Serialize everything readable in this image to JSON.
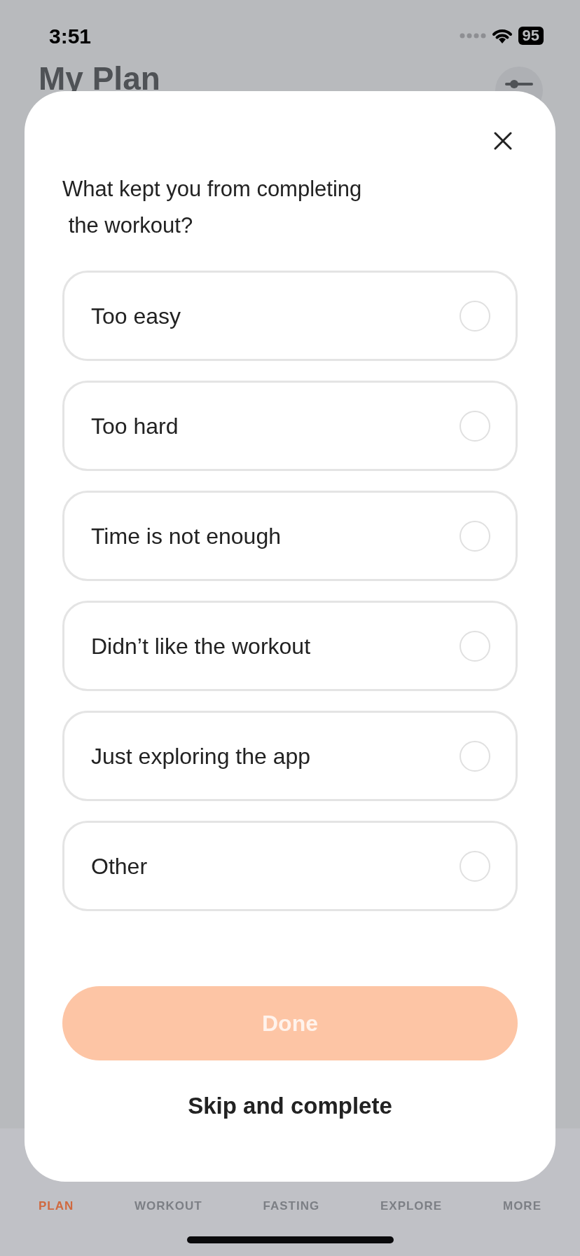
{
  "status_bar": {
    "time": "3:51",
    "battery": "95"
  },
  "header": {
    "title": "My Plan"
  },
  "sheet": {
    "question": "What kept you from completing\n the workout?",
    "options": [
      {
        "label": "Too easy",
        "selected": false
      },
      {
        "label": "Too hard",
        "selected": false
      },
      {
        "label": "Time is not enough",
        "selected": false
      },
      {
        "label": "Didn’t like the workout",
        "selected": false
      },
      {
        "label": "Just exploring the app",
        "selected": false
      },
      {
        "label": "Other",
        "selected": false
      }
    ],
    "done_button": {
      "label": "Done",
      "disabled": true
    },
    "skip_link": "Skip and complete"
  },
  "tab_bar": [
    {
      "label": "PLAN",
      "selected": true
    },
    {
      "label": "WORKOUT",
      "selected": false
    },
    {
      "label": "FASTING",
      "selected": false
    },
    {
      "label": "EXPLORE",
      "selected": false
    },
    {
      "label": "MORE",
      "selected": false
    }
  ]
}
